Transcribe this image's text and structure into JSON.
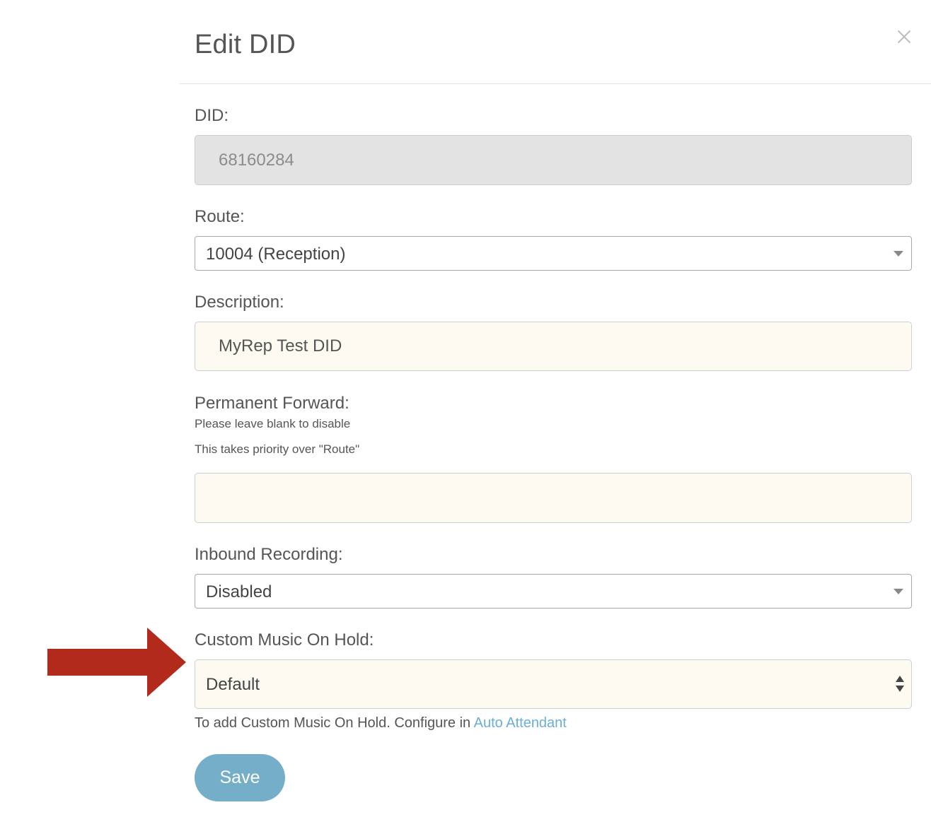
{
  "modal": {
    "title": "Edit DID",
    "close_icon": "close-icon"
  },
  "fields": {
    "did": {
      "label": "DID:",
      "value": "68160284"
    },
    "route": {
      "label": "Route:",
      "selected": "10004 (Reception)"
    },
    "description": {
      "label": "Description:",
      "value": "MyRep Test DID"
    },
    "permanent_forward": {
      "label": "Permanent Forward:",
      "help_1": "Please leave blank to disable",
      "help_2": "This takes priority over \"Route\"",
      "value": ""
    },
    "inbound_recording": {
      "label": "Inbound Recording:",
      "selected": "Disabled"
    },
    "custom_moh": {
      "label": "Custom Music On Hold:",
      "selected": "Default",
      "note_prefix": "To add Custom Music On Hold. Configure in",
      "note_link": "Auto Attendant"
    }
  },
  "actions": {
    "save_label": "Save"
  },
  "colors": {
    "accent": "#75aec8",
    "link": "#6aaed6",
    "annotation_arrow": "#b22a1c",
    "input_background": "#fdfaf2",
    "disabled_background": "#e3e3e3"
  }
}
